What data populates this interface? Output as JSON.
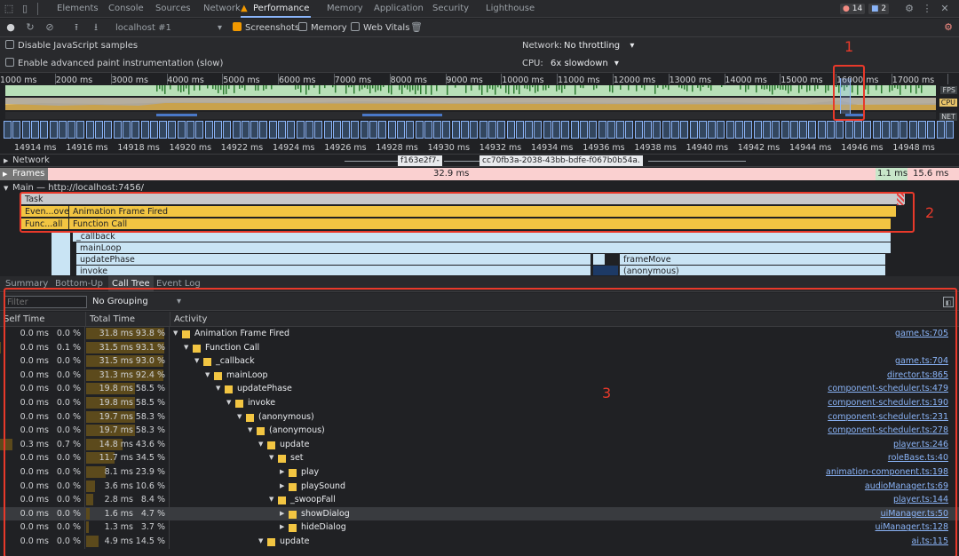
{
  "tabs": [
    "Elements",
    "Console",
    "Sources",
    "Network",
    "Performance",
    "Memory",
    "Application",
    "Security",
    "Lighthouse"
  ],
  "badges": {
    "errors": "14",
    "messages": "2"
  },
  "toolbar": {
    "target": "localhost #1",
    "screenshots": "Screenshots",
    "memory": "Memory",
    "web_vitals": "Web Vitals"
  },
  "settings": {
    "disable_js": "Disable JavaScript samples",
    "advanced_paint": "Enable advanced paint instrumentation (slow)",
    "network_label": "Network:",
    "network_value": "No throttling",
    "cpu_label": "CPU:",
    "cpu_value": "6x slowdown"
  },
  "overview": {
    "ticks": [
      "1000 ms",
      "2000 ms",
      "3000 ms",
      "4000 ms",
      "5000 ms",
      "6000 ms",
      "7000 ms",
      "8000 ms",
      "9000 ms",
      "10000 ms",
      "11000 ms",
      "12000 ms",
      "13000 ms",
      "14000 ms",
      "15000 ms",
      "16000 ms",
      "17000 ms"
    ],
    "fps_label": "FPS",
    "cpu_label": "CPU",
    "net_label": "NET"
  },
  "detail_ticks": [
    "14914 ms",
    "14916 ms",
    "14918 ms",
    "14920 ms",
    "14922 ms",
    "14924 ms",
    "14926 ms",
    "14928 ms",
    "14930 ms",
    "14932 ms",
    "14934 ms",
    "14936 ms",
    "14938 ms",
    "14940 ms",
    "14942 ms",
    "14944 ms",
    "14946 ms",
    "14948 ms"
  ],
  "tracks": {
    "network": "Network",
    "net_req1": "f163e2f7-",
    "net_req2": "cc70fb3a-2038-43bb-bdfe-f067b0b54a.",
    "frames": "Frames",
    "frame1": "32.9 ms",
    "frame2": "1.1 ms",
    "frame3": "15.6 ms",
    "main": "Main — http://localhost:7456/"
  },
  "flame": {
    "task": "Task",
    "event": "Even...ove",
    "animation": "Animation Frame Fired",
    "func_short": "Func...all",
    "function_call": "Function Call",
    "callback": "_callback",
    "mainloop": "mainLoop",
    "updatephase": "updatePhase",
    "invoke": "invoke",
    "framemove": "frameMove",
    "anonymous": "(anonymous)"
  },
  "bottom_tabs": [
    "Summary",
    "Bottom-Up",
    "Call Tree",
    "Event Log"
  ],
  "filter_placeholder": "Filter",
  "grouping": "No Grouping",
  "headers": {
    "self": "Self Time",
    "total": "Total Time",
    "activity": "Activity"
  },
  "rows": [
    {
      "self_ms": "0.0 ms",
      "self_pct": "0.0 %",
      "total_ms": "31.8 ms",
      "total_pct": "93.8 %",
      "total_frac": 0.938,
      "self_frac": 0,
      "depth": 0,
      "expanded": true,
      "name": "Animation Frame Fired",
      "src": "game.ts:705"
    },
    {
      "self_ms": "0.0 ms",
      "self_pct": "0.1 %",
      "total_ms": "31.5 ms",
      "total_pct": "93.1 %",
      "total_frac": 0.931,
      "self_frac": 0.001,
      "depth": 1,
      "expanded": true,
      "name": "Function Call",
      "src": ""
    },
    {
      "self_ms": "0.0 ms",
      "self_pct": "0.0 %",
      "total_ms": "31.5 ms",
      "total_pct": "93.0 %",
      "total_frac": 0.93,
      "self_frac": 0,
      "depth": 2,
      "expanded": true,
      "name": "_callback",
      "src": "game.ts:704"
    },
    {
      "self_ms": "0.0 ms",
      "self_pct": "0.0 %",
      "total_ms": "31.3 ms",
      "total_pct": "92.4 %",
      "total_frac": 0.924,
      "self_frac": 0,
      "depth": 3,
      "expanded": true,
      "name": "mainLoop",
      "src": "director.ts:865"
    },
    {
      "self_ms": "0.0 ms",
      "self_pct": "0.0 %",
      "total_ms": "19.8 ms",
      "total_pct": "58.5 %",
      "total_frac": 0.585,
      "self_frac": 0,
      "depth": 4,
      "expanded": true,
      "name": "updatePhase",
      "src": "component-scheduler.ts:479"
    },
    {
      "self_ms": "0.0 ms",
      "self_pct": "0.0 %",
      "total_ms": "19.8 ms",
      "total_pct": "58.5 %",
      "total_frac": 0.585,
      "self_frac": 0,
      "depth": 5,
      "expanded": true,
      "name": "invoke",
      "src": "component-scheduler.ts:190"
    },
    {
      "self_ms": "0.0 ms",
      "self_pct": "0.0 %",
      "total_ms": "19.7 ms",
      "total_pct": "58.3 %",
      "total_frac": 0.583,
      "self_frac": 0,
      "depth": 6,
      "expanded": true,
      "name": "(anonymous)",
      "src": "component-scheduler.ts:231"
    },
    {
      "self_ms": "0.0 ms",
      "self_pct": "0.0 %",
      "total_ms": "19.7 ms",
      "total_pct": "58.3 %",
      "total_frac": 0.583,
      "self_frac": 0,
      "depth": 7,
      "expanded": true,
      "name": "(anonymous)",
      "src": "component-scheduler.ts:278"
    },
    {
      "self_ms": "0.3 ms",
      "self_pct": "0.7 %",
      "total_ms": "14.8 ms",
      "total_pct": "43.6 %",
      "total_frac": 0.436,
      "self_frac": 0.15,
      "depth": 8,
      "expanded": true,
      "name": "update",
      "src": "player.ts:246"
    },
    {
      "self_ms": "0.0 ms",
      "self_pct": "0.0 %",
      "total_ms": "11.7 ms",
      "total_pct": "34.5 %",
      "total_frac": 0.345,
      "self_frac": 0,
      "depth": 9,
      "expanded": true,
      "name": "set",
      "src": "roleBase.ts:40"
    },
    {
      "self_ms": "0.0 ms",
      "self_pct": "0.0 %",
      "total_ms": "8.1 ms",
      "total_pct": "23.9 %",
      "total_frac": 0.239,
      "self_frac": 0,
      "depth": 10,
      "expanded": false,
      "name": "play",
      "src": "animation-component.ts:198"
    },
    {
      "self_ms": "0.0 ms",
      "self_pct": "0.0 %",
      "total_ms": "3.6 ms",
      "total_pct": "10.6 %",
      "total_frac": 0.106,
      "self_frac": 0,
      "depth": 10,
      "expanded": false,
      "name": "playSound",
      "src": "audioManager.ts:69"
    },
    {
      "self_ms": "0.0 ms",
      "self_pct": "0.0 %",
      "total_ms": "2.8 ms",
      "total_pct": "8.4 %",
      "total_frac": 0.084,
      "self_frac": 0,
      "depth": 9,
      "expanded": true,
      "name": "_swoopFall",
      "src": "player.ts:144"
    },
    {
      "self_ms": "0.0 ms",
      "self_pct": "0.0 %",
      "total_ms": "1.6 ms",
      "total_pct": "4.7 %",
      "total_frac": 0.047,
      "self_frac": 0,
      "depth": 10,
      "expanded": false,
      "name": "showDialog",
      "src": "uiManager.ts:50",
      "selected": true
    },
    {
      "self_ms": "0.0 ms",
      "self_pct": "0.0 %",
      "total_ms": "1.3 ms",
      "total_pct": "3.7 %",
      "total_frac": 0.037,
      "self_frac": 0,
      "depth": 10,
      "expanded": false,
      "name": "hideDialog",
      "src": "uiManager.ts:128"
    },
    {
      "self_ms": "0.0 ms",
      "self_pct": "0.0 %",
      "total_ms": "4.9 ms",
      "total_pct": "14.5 %",
      "total_frac": 0.145,
      "self_frac": 0,
      "depth": 8,
      "expanded": true,
      "name": "update",
      "src": "ai.ts:115"
    }
  ],
  "annotations": [
    "1",
    "2",
    "3"
  ],
  "colors": {
    "accent": "#8ab4f8",
    "highlight": "#e8392a",
    "fps": "#b8e0b8",
    "cpu": "#e8c46a",
    "frame_bar": "#5c4a1c"
  }
}
